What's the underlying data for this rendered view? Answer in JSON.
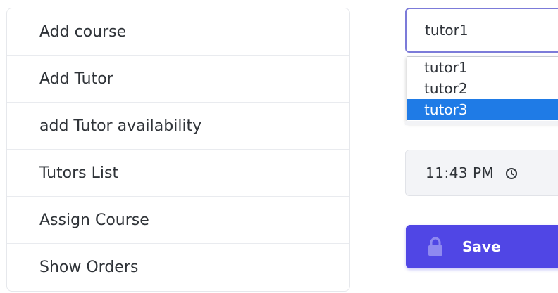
{
  "menu": {
    "items": [
      {
        "label": "Add course"
      },
      {
        "label": "Add Tutor"
      },
      {
        "label": "add Tutor availability"
      },
      {
        "label": "Tutors List"
      },
      {
        "label": "Assign Course"
      },
      {
        "label": "Show Orders"
      }
    ]
  },
  "form": {
    "tutor_select": {
      "value": "tutor1",
      "options": [
        "tutor1",
        "tutor2",
        "tutor3"
      ],
      "highlighted_option": "tutor3"
    },
    "time": {
      "value": "11:43 PM",
      "icon": "clock-icon"
    },
    "save_button": {
      "label": "Save",
      "icon": "lock-icon"
    }
  },
  "colors": {
    "accent": "#5046e5",
    "select_border": "#7c7bd9",
    "option_highlight": "#1f7be6"
  }
}
